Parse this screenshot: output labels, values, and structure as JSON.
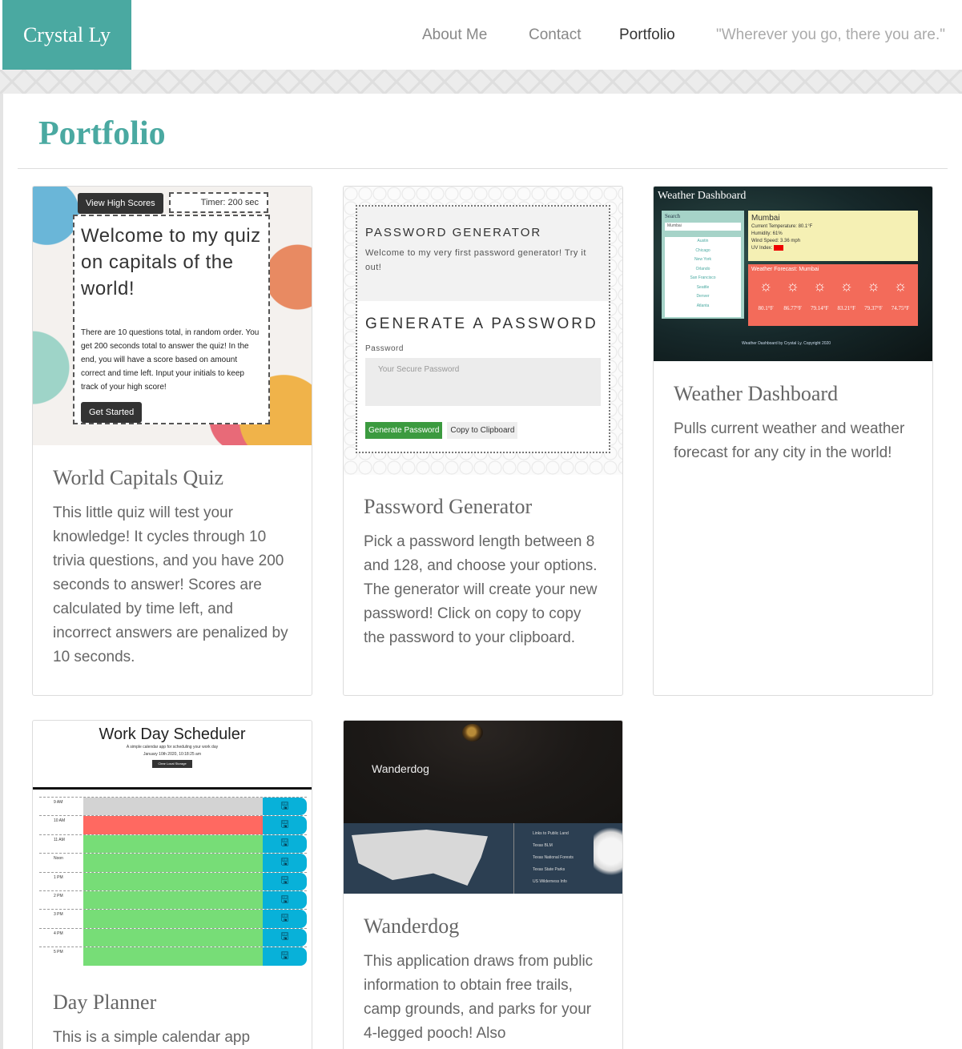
{
  "header": {
    "brand": "Crystal Ly",
    "nav": [
      {
        "label": "About Me"
      },
      {
        "label": "Contact"
      },
      {
        "label": "Portfolio"
      }
    ],
    "quote": "\"Wherever you go, there you are.\""
  },
  "page_title": "Portfolio",
  "projects": [
    {
      "title": "World Capitals Quiz",
      "description": "This little quiz will test your knowledge! It cycles through 10 trivia questions, and you have 200 seconds to answer! Scores are calculated by time left, and incorrect answers are penalized by 10 seconds.",
      "thumb": {
        "view_high_scores": "View High Scores",
        "timer": "Timer: 200 sec",
        "heading": "Welcome to my quiz on capitals of the world!",
        "body": "There are 10 questions total, in random order. You get 200 seconds total to answer the quiz! In the end, you will have a score based on amount correct and time left. Input your initials to keep track of your high score!",
        "button": "Get Started"
      }
    },
    {
      "title": "Password Generator",
      "description": "Pick a password length between 8 and 128, and choose your options. The generator will create your new password! Click on copy to copy the password to your clipboard.",
      "thumb": {
        "header": "PASSWORD GENERATOR",
        "intro": "Welcome to my very first password generator! Try it out!",
        "heading": "GENERATE A PASSWORD",
        "label": "Password",
        "placeholder": "Your Secure Password",
        "generate_button": "Generate Password",
        "copy_button": "Copy to Clipboard"
      }
    },
    {
      "title": "Weather Dashboard",
      "description": "Pulls current weather and weather forecast for any city in the world!",
      "thumb": {
        "title": "Weather Dashboard",
        "search_label": "Search",
        "search_value": "Mumbai",
        "cities": [
          "Austin",
          "Chicago",
          "New York",
          "Orlando",
          "San Francisco",
          "Seattle",
          "Denver",
          "Atlanta"
        ],
        "city": "Mumbai",
        "current_temp": "Current Temperature: 80.1°F",
        "humidity": "Humidity: 61%",
        "wind": "Wind Speed: 3.36 mph",
        "uv": "UV Index:",
        "forecast_label": "Weather Forecast: Mumbai",
        "forecast_temps": [
          "80.1°F",
          "86.77°F",
          "79.14°F",
          "83.21°F",
          "79.37°F",
          "74.75°F"
        ],
        "footer": "Weather Dashboard by Crystal Ly. Copyright 2020"
      }
    },
    {
      "title": "Day Planner",
      "description": "This is a simple calendar app",
      "thumb": {
        "title": "Work Day Scheduler",
        "subtitle": "A simple calendar app for scheduling your work day",
        "date": "January 10th 2020, 10:18:25 am",
        "clear_button": "Clear Local Storage",
        "hours": [
          "9 AM",
          "10 AM",
          "11 AM",
          "Noon",
          "1 PM",
          "2 PM",
          "3 PM",
          "4 PM",
          "5 PM"
        ],
        "slot_states": [
          "past",
          "present",
          "future",
          "future",
          "future",
          "future",
          "future",
          "future",
          "future"
        ],
        "colors": {
          "past": "#d3d3d3",
          "present": "#ff6961",
          "future": "#77dd77"
        }
      }
    },
    {
      "title": "Wanderdog",
      "description": "This application draws from public information to obtain free trails, camp grounds, and parks for your 4-legged pooch! Also",
      "thumb": {
        "logo": "Wanderdog",
        "links_title": "Links to Public Land",
        "links": [
          "Texas BLM",
          "Texas National Forests",
          "Texas State Parks",
          "US Wilderness Info"
        ]
      }
    }
  ],
  "colors": {
    "accent": "#4aa9a1"
  }
}
